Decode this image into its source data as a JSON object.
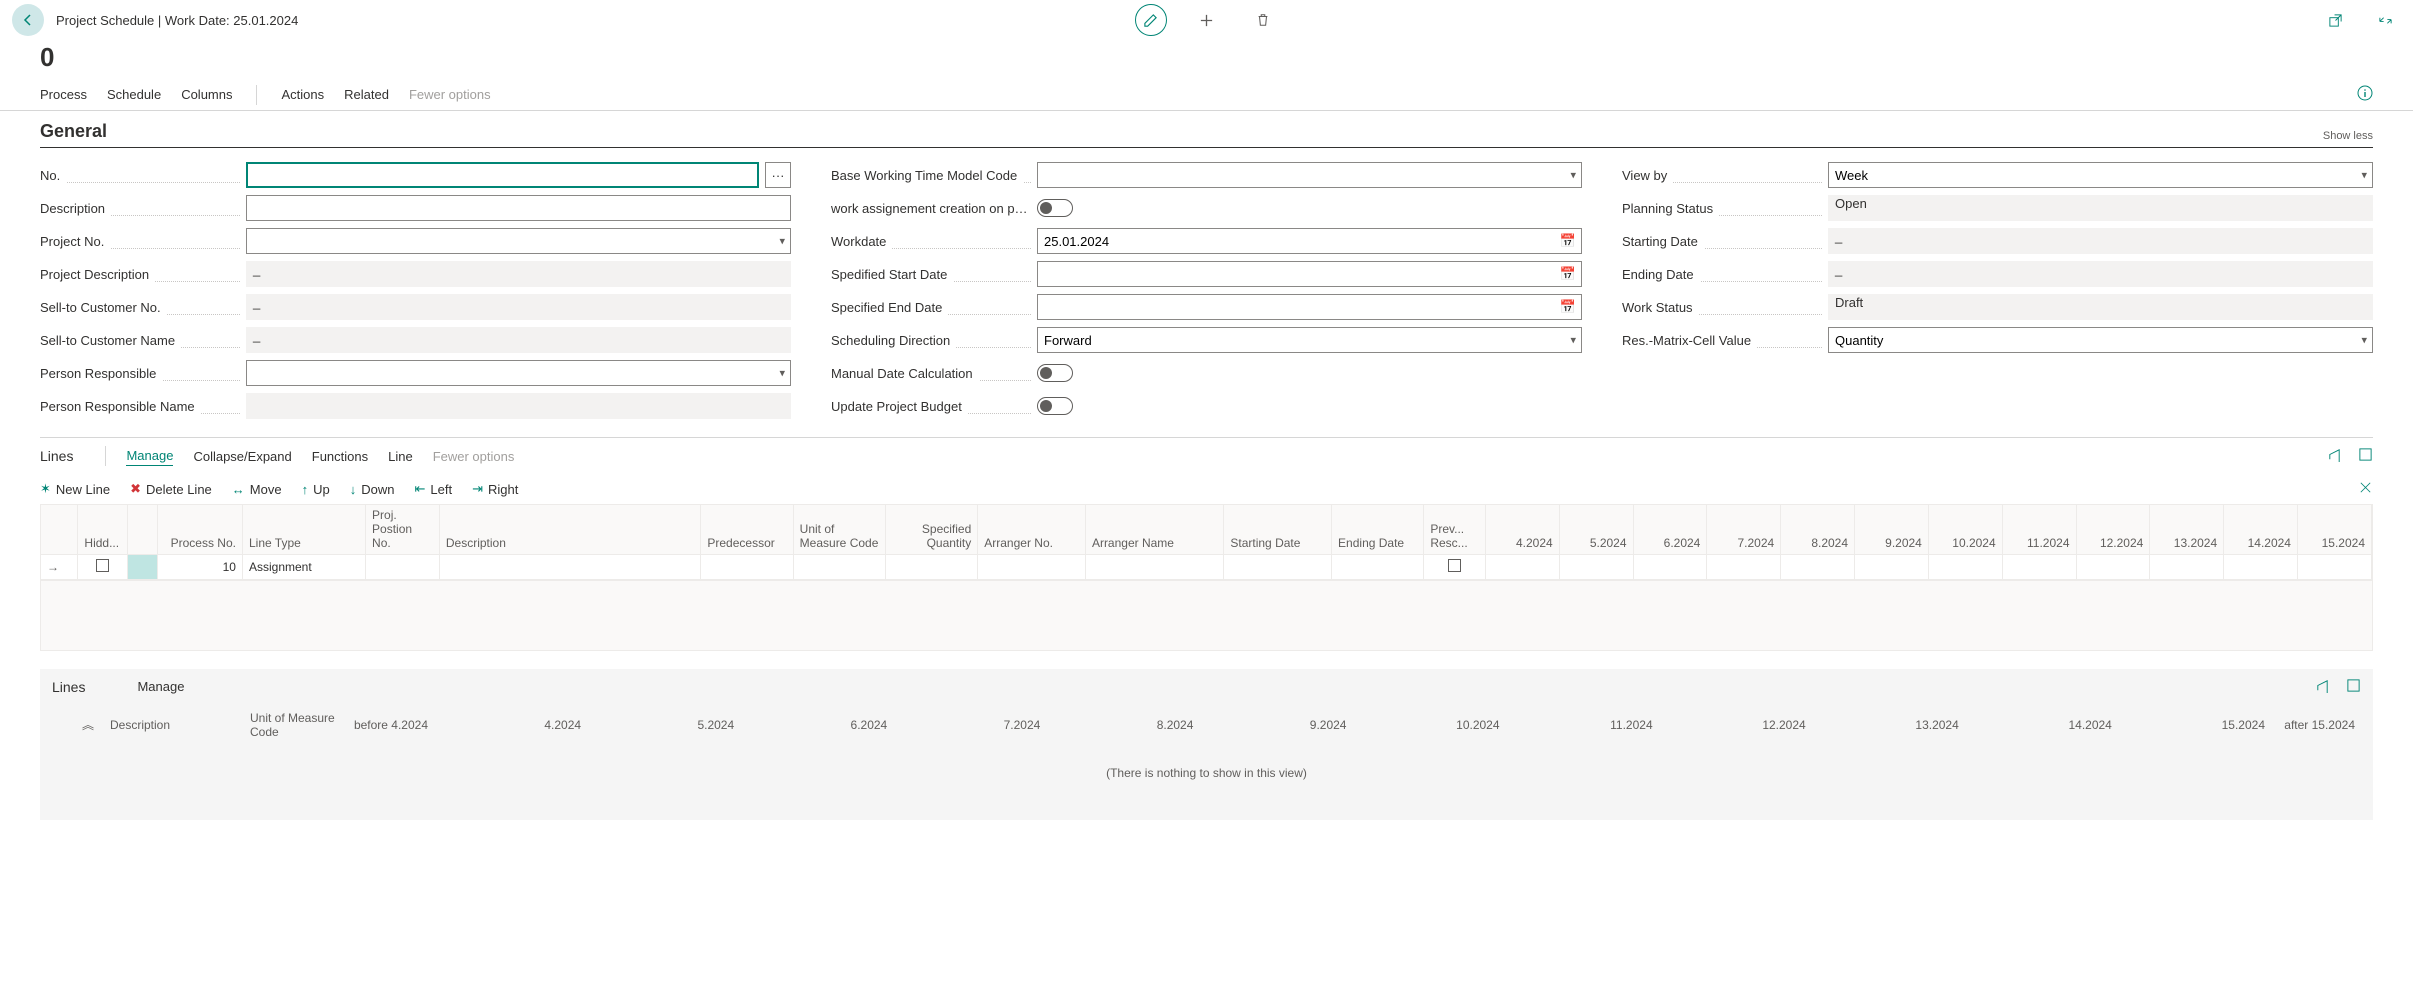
{
  "header": {
    "breadcrumb": "Project Schedule | Work Date: 25.01.2024",
    "zero": "0"
  },
  "tabs": {
    "process": "Process",
    "schedule": "Schedule",
    "columns": "Columns",
    "actions": "Actions",
    "related": "Related",
    "fewer": "Fewer options"
  },
  "general": {
    "title": "General",
    "show_less": "Show less",
    "col1": {
      "no_label": "No.",
      "no_value": "",
      "description_label": "Description",
      "description_value": "",
      "project_no_label": "Project No.",
      "project_no_value": "",
      "project_desc_label": "Project Description",
      "project_desc_value": "_",
      "sell_to_no_label": "Sell-to Customer No.",
      "sell_to_no_value": "_",
      "sell_to_name_label": "Sell-to Customer Name",
      "sell_to_name_value": "_",
      "person_resp_label": "Person Responsible",
      "person_resp_value": "",
      "person_resp_name_label": "Person Responsible Name",
      "person_resp_name_value": ""
    },
    "col2": {
      "base_wtm_label": "Base Working Time Model Code",
      "base_wtm_value": "",
      "work_assign_label": "work assignement creation on project schedul...",
      "workdate_label": "Workdate",
      "workdate_value": "25.01.2024",
      "spec_start_label": "Spedified Start Date",
      "spec_start_value": "",
      "spec_end_label": "Specified End Date",
      "spec_end_value": "",
      "sched_dir_label": "Scheduling Direction",
      "sched_dir_value": "Forward",
      "manual_calc_label": "Manual Date Calculation",
      "update_budget_label": "Update Project Budget"
    },
    "col3": {
      "view_by_label": "View by",
      "view_by_value": "Week",
      "planning_status_label": "Planning Status",
      "planning_status_value": "Open",
      "start_date_label": "Starting Date",
      "start_date_value": "_",
      "end_date_label": "Ending Date",
      "end_date_value": "_",
      "work_status_label": "Work Status",
      "work_status_value": "Draft",
      "res_matrix_label": "Res.-Matrix-Cell Value",
      "res_matrix_value": "Quantity"
    }
  },
  "lines": {
    "title": "Lines",
    "tabs": {
      "manage": "Manage",
      "collapse": "Collapse/Expand",
      "functions": "Functions",
      "line": "Line",
      "fewer": "Fewer options"
    },
    "toolbar": {
      "new_line": "New Line",
      "delete_line": "Delete Line",
      "move": "Move",
      "up": "Up",
      "down": "Down",
      "left": "Left",
      "right": "Right"
    },
    "headers": {
      "hidd": "Hidd...",
      "process_no": "Process No.",
      "line_type": "Line Type",
      "proj_pos": "Proj. Postion No.",
      "description": "Description",
      "predecessor": "Predecessor",
      "uom": "Unit of Measure Code",
      "spec_qty": "Specified Quantity",
      "arranger_no": "Arranger No.",
      "arranger_name": "Arranger Name",
      "starting_date": "Starting Date",
      "ending_date": "Ending Date",
      "prev_resc": "Prev... Resc...",
      "w4": "4.2024",
      "w5": "5.2024",
      "w6": "6.2024",
      "w7": "7.2024",
      "w8": "8.2024",
      "w9": "9.2024",
      "w10": "10.2024",
      "w11": "11.2024",
      "w12": "12.2024",
      "w13": "13.2024",
      "w14": "14.2024",
      "w15": "15.2024"
    },
    "row": {
      "process_no": "10",
      "line_type": "Assignment"
    }
  },
  "lines2": {
    "title": "Lines",
    "manage": "Manage",
    "headers": {
      "description": "Description",
      "uom": "Unit of Measure Code",
      "before": "before 4.2024",
      "w4": "4.2024",
      "w5": "5.2024",
      "w6": "6.2024",
      "w7": "7.2024",
      "w8": "8.2024",
      "w9": "9.2024",
      "w10": "10.2024",
      "w11": "11.2024",
      "w12": "12.2024",
      "w13": "13.2024",
      "w14": "14.2024",
      "w15": "15.2024",
      "after": "after 15.2024"
    },
    "empty": "(There is nothing to show in this view)"
  }
}
